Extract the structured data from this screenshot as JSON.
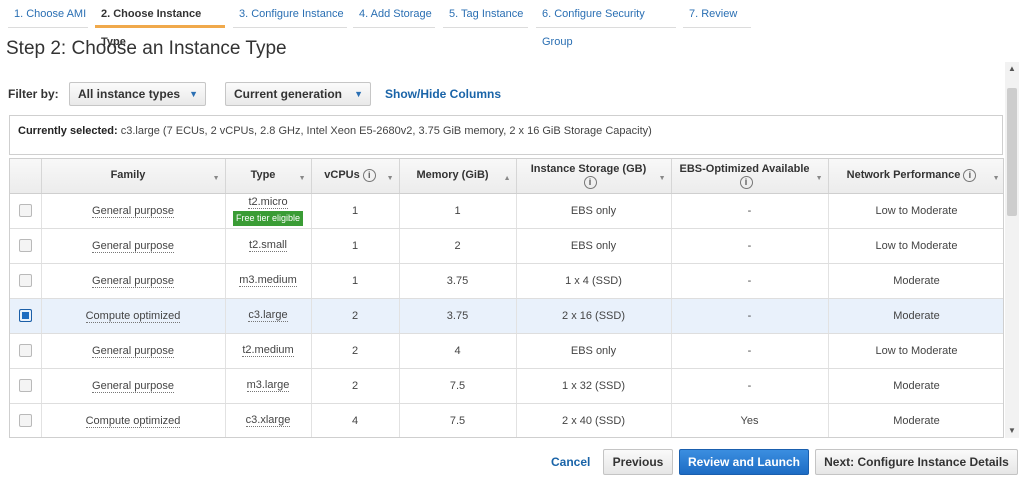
{
  "wizard": {
    "steps": [
      {
        "label": "1. Choose AMI"
      },
      {
        "label": "2. Choose Instance Type"
      },
      {
        "label": "3. Configure Instance"
      },
      {
        "label": "4. Add Storage"
      },
      {
        "label": "5. Tag Instance"
      },
      {
        "label": "6. Configure Security Group"
      },
      {
        "label": "7. Review"
      }
    ],
    "active_index": 1
  },
  "page_title": "Step 2: Choose an Instance Type",
  "filter": {
    "label": "Filter by:",
    "instance_types": "All instance types",
    "generation": "Current generation",
    "show_hide": "Show/Hide Columns"
  },
  "selected": {
    "prefix": "Currently selected:",
    "text": "c3.large (7 ECUs, 2 vCPUs, 2.8 GHz, Intel Xeon E5-2680v2, 3.75 GiB memory, 2 x 16 GiB Storage Capacity)"
  },
  "table": {
    "headers": {
      "family": "Family",
      "type": "Type",
      "vcpus": "vCPUs",
      "memory": "Memory (GiB)",
      "storage": "Instance Storage (GB)",
      "ebs": "EBS-Optimized Available",
      "network": "Network Performance"
    },
    "rows": [
      {
        "family": "General purpose",
        "type": "t2.micro",
        "badge": "Free tier eligible",
        "vcpus": "1",
        "memory": "1",
        "storage": "EBS only",
        "ebs": "-",
        "network": "Low to Moderate",
        "selected": false
      },
      {
        "family": "General purpose",
        "type": "t2.small",
        "badge": "",
        "vcpus": "1",
        "memory": "2",
        "storage": "EBS only",
        "ebs": "-",
        "network": "Low to Moderate",
        "selected": false
      },
      {
        "family": "General purpose",
        "type": "m3.medium",
        "badge": "",
        "vcpus": "1",
        "memory": "3.75",
        "storage": "1 x 4 (SSD)",
        "ebs": "-",
        "network": "Moderate",
        "selected": false
      },
      {
        "family": "Compute optimized",
        "type": "c3.large",
        "badge": "",
        "vcpus": "2",
        "memory": "3.75",
        "storage": "2 x 16 (SSD)",
        "ebs": "-",
        "network": "Moderate",
        "selected": true
      },
      {
        "family": "General purpose",
        "type": "t2.medium",
        "badge": "",
        "vcpus": "2",
        "memory": "4",
        "storage": "EBS only",
        "ebs": "-",
        "network": "Low to Moderate",
        "selected": false
      },
      {
        "family": "General purpose",
        "type": "m3.large",
        "badge": "",
        "vcpus": "2",
        "memory": "7.5",
        "storage": "1 x 32 (SSD)",
        "ebs": "-",
        "network": "Moderate",
        "selected": false
      },
      {
        "family": "Compute optimized",
        "type": "c3.xlarge",
        "badge": "",
        "vcpus": "4",
        "memory": "7.5",
        "storage": "2 x 40 (SSD)",
        "ebs": "Yes",
        "network": "Moderate",
        "selected": false
      }
    ]
  },
  "footer": {
    "cancel": "Cancel",
    "previous": "Previous",
    "review_launch": "Review and Launch",
    "next": "Next: Configure Instance Details"
  },
  "colors": {
    "accent": "#1d6cc4",
    "active_tab": "#f0a94b",
    "badge": "#3a9c35",
    "selected_row": "#e9f1fb"
  }
}
